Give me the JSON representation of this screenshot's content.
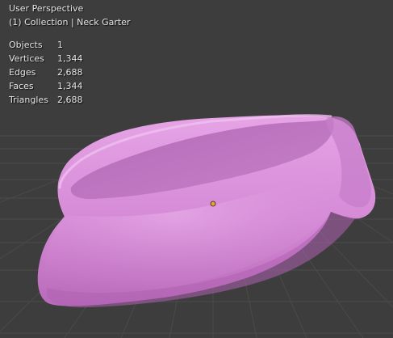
{
  "viewport": {
    "view_name": "User Perspective",
    "collection_label": "(1) Collection | Neck Garter",
    "stats": [
      {
        "label": "Objects",
        "value": "1"
      },
      {
        "label": "Vertices",
        "value": "1,344"
      },
      {
        "label": "Edges",
        "value": "2,688"
      },
      {
        "label": "Faces",
        "value": "1,344"
      },
      {
        "label": "Triangles",
        "value": "2,688"
      }
    ],
    "colors": {
      "background": "#3d3d3d",
      "grid": "#4a4a4a",
      "mesh": "#d58ad6",
      "origin": "#f0a02a"
    }
  }
}
